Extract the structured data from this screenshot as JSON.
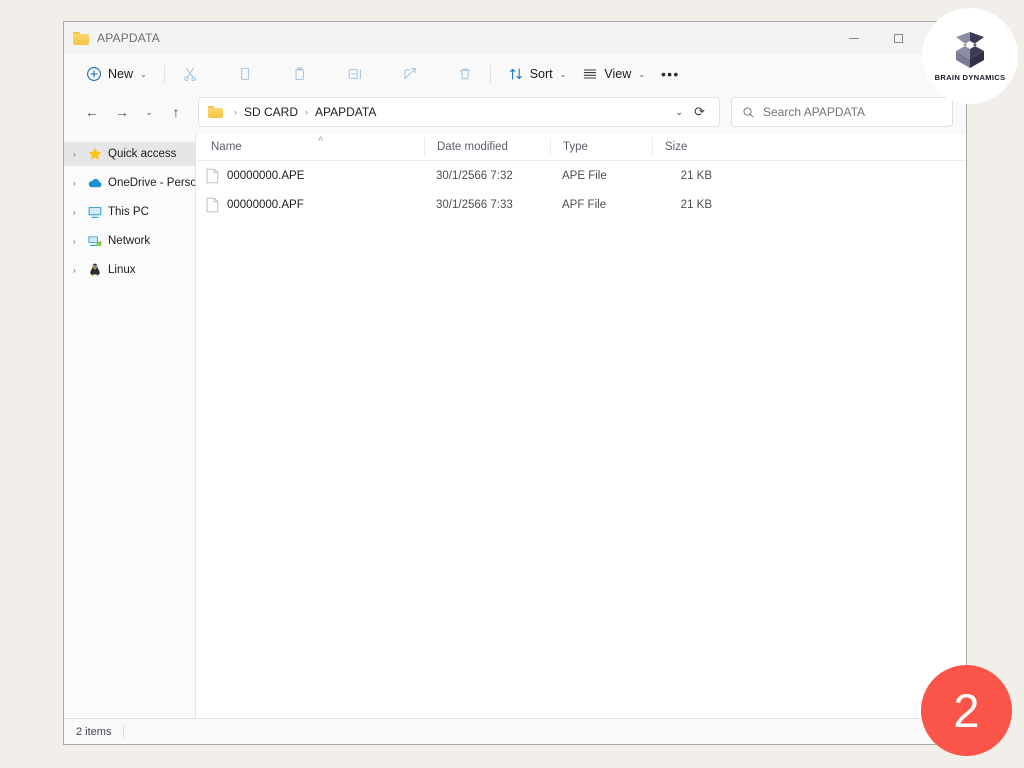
{
  "window": {
    "title": "APAPDATA",
    "title_icon": "folder-icon",
    "controls": {
      "minimize": "─",
      "maximize": "☐",
      "close": "✕"
    }
  },
  "toolbar": {
    "new_label": "New",
    "new_icon": "plus-circle-icon",
    "actions": [
      {
        "name": "cut",
        "icon": "scissors-icon",
        "enabled": false
      },
      {
        "name": "copy",
        "icon": "copy-icon",
        "enabled": false
      },
      {
        "name": "paste",
        "icon": "paste-icon",
        "enabled": false
      },
      {
        "name": "rename",
        "icon": "rename-icon",
        "enabled": false
      },
      {
        "name": "share",
        "icon": "share-icon",
        "enabled": false
      },
      {
        "name": "delete",
        "icon": "trash-icon",
        "enabled": false
      }
    ],
    "sort_label": "Sort",
    "sort_icon": "sort-arrows-icon",
    "view_label": "View",
    "view_icon": "view-lines-icon",
    "overflow_label": "•••",
    "chevron": "⌄"
  },
  "addressbar": {
    "back_icon": "←",
    "forward_icon": "→",
    "recent_icon": "⌄",
    "up_icon": "↑",
    "breadcrumb": [
      "SD CARD",
      "APAPDATA"
    ],
    "separator": "›",
    "dropdown_icon": "⌄",
    "refresh_icon": "⟳",
    "search_placeholder": "Search APAPDATA",
    "search_value": "",
    "search_icon": "search-icon"
  },
  "sidebar": {
    "items": [
      {
        "label": "Quick access",
        "icon": "star-icon",
        "selected": true,
        "expander": "›"
      },
      {
        "label": "OneDrive - Persona",
        "icon": "cloud-icon",
        "selected": false,
        "expander": "›"
      },
      {
        "label": "This PC",
        "icon": "monitor-icon",
        "selected": false,
        "expander": "›"
      },
      {
        "label": "Network",
        "icon": "network-icon",
        "selected": false,
        "expander": "›"
      },
      {
        "label": "Linux",
        "icon": "penguin-icon",
        "selected": false,
        "expander": "›"
      }
    ]
  },
  "filelist": {
    "columns": [
      {
        "key": "name",
        "label": "Name"
      },
      {
        "key": "date",
        "label": "Date modified"
      },
      {
        "key": "type",
        "label": "Type"
      },
      {
        "key": "size",
        "label": "Size"
      }
    ],
    "sort_column": "Name",
    "sort_indicator": "˄",
    "rows": [
      {
        "name": "00000000.APE",
        "date": "30/1/2566 7:32",
        "type": "APE File",
        "size": "21 KB",
        "icon": "file-icon"
      },
      {
        "name": "00000000.APF",
        "date": "30/1/2566 7:33",
        "type": "APF File",
        "size": "21 KB",
        "icon": "file-icon"
      }
    ]
  },
  "statusbar": {
    "item_count": "2 items",
    "view_buttons": [
      {
        "name": "details-view",
        "icon": "details-view-icon",
        "active": true
      }
    ]
  },
  "overlays": {
    "brand": {
      "name": "BRAIN DYNAMICS",
      "icon": "brand-mark-icon"
    },
    "step_badge": {
      "number": "2",
      "color": "#fb5449"
    }
  },
  "colors": {
    "page_background": "#f2efea",
    "window_background": "#ffffff",
    "titlebar": "#f3f3f3",
    "toolbar": "#f9f9f9",
    "accent_blue": "#0f6cbd",
    "folder_yellow": "#f5c443",
    "badge_red": "#fb5449",
    "selected_row": "#e6e6e6"
  }
}
